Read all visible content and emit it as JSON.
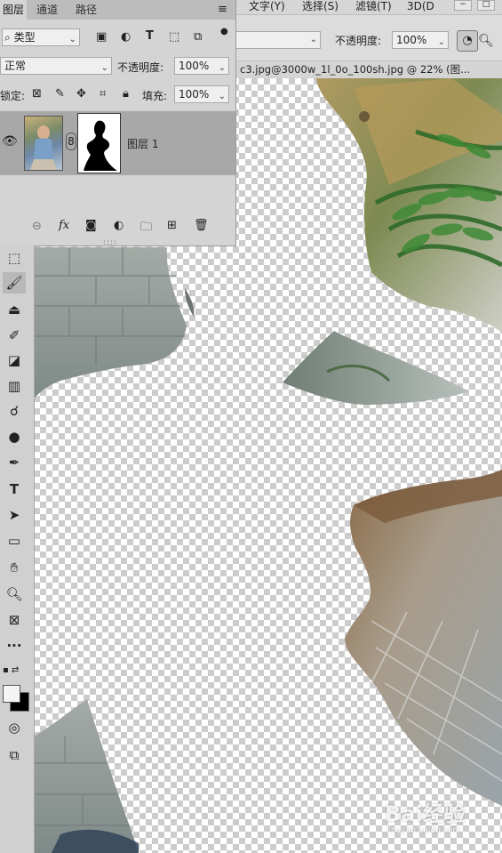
{
  "menubar": {
    "items": [
      "文字(Y)",
      "选择(S)",
      "滤镜(T)",
      "3D(D"
    ]
  },
  "options": {
    "opacity_label": "不透明度:",
    "opacity_value": "100%"
  },
  "document_tab": {
    "title": "c3.jpg@3000w_1l_0o_100sh.jpg @ 22% (图..."
  },
  "layers_panel": {
    "tabs": [
      "图层",
      "通道",
      "路径"
    ],
    "active_tab": "图层",
    "filter_kind": "类型",
    "blend_mode": "正常",
    "opacity_label": "不透明度:",
    "opacity_value": "100%",
    "lock_label": "锁定:",
    "fill_label": "填充:",
    "fill_value": "100%",
    "layer": {
      "name": "图层 1"
    },
    "footer_fx": "fx"
  },
  "toolbar": {
    "tools": [
      "rect-marquee",
      "brush",
      "clone-stamp",
      "history-brush",
      "eraser",
      "gradient",
      "smudge",
      "dodge",
      "pen",
      "type",
      "path-selection",
      "rectangle",
      "hand",
      "zoom",
      "frame",
      "more",
      "swap-colors",
      "color-swatches",
      "quick-mask",
      "screen-mode"
    ],
    "selected": "brush",
    "type_glyph": "T",
    "more_glyph": "···"
  },
  "watermark": {
    "brand": "Bai经验",
    "url": "jingyan.baidu.com"
  },
  "colors": {
    "panel_bg": "#d4d4d4",
    "selected_layer": "#a8a8a8",
    "toolbar_bg": "#d0d0d0"
  }
}
